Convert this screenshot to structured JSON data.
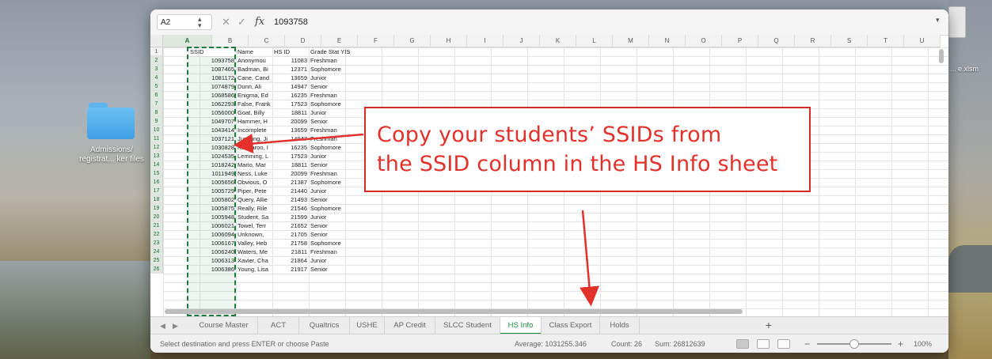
{
  "desktop": {
    "folder_label_line1": "Admissions/",
    "folder_label_line2": "registrat... ker files",
    "right_file_label": "... e.xlsm"
  },
  "formula_bar": {
    "name_box": "A2",
    "fx": "fx",
    "value": "1093758"
  },
  "columns": [
    "A",
    "B",
    "C",
    "D",
    "E",
    "F",
    "G",
    "H",
    "I",
    "J",
    "K",
    "L",
    "M",
    "N",
    "O",
    "P",
    "Q",
    "R",
    "S",
    "T",
    "U"
  ],
  "rows": [
    {
      "n": "1",
      "a": "SSID",
      "b": "Name",
      "c": "HS ID",
      "d": "Grade Stat YIS"
    },
    {
      "n": "2",
      "a": "1093758",
      "b": "Anonymou",
      "c": "11083",
      "d": "Freshman"
    },
    {
      "n": "3",
      "a": "1087465",
      "b": "Badman, Bi",
      "c": "12371",
      "d": "Sophomore"
    },
    {
      "n": "4",
      "a": "1081172",
      "b": "Cane, Cand",
      "c": "13659",
      "d": "Junior"
    },
    {
      "n": "5",
      "a": "1074879",
      "b": "Dunn, Ali",
      "c": "14947",
      "d": "Senior"
    },
    {
      "n": "6",
      "a": "1068586",
      "b": "Enigma, Ed",
      "c": "16235",
      "d": "Freshman"
    },
    {
      "n": "7",
      "a": "1062293",
      "b": "False, Frank",
      "c": "17523",
      "d": "Sophomore"
    },
    {
      "n": "8",
      "a": "1056000",
      "b": "Goat, Billy",
      "c": "18811",
      "d": "Junior"
    },
    {
      "n": "9",
      "a": "1049707",
      "b": "Hammer, H",
      "c": "20099",
      "d": "Senior"
    },
    {
      "n": "10",
      "a": "1043414",
      "b": "Incomplete",
      "c": "13659",
      "d": "Freshman"
    },
    {
      "n": "11",
      "a": "1037121",
      "b": "Jumping, Ji",
      "c": "14947",
      "d": "Freshman"
    },
    {
      "n": "12",
      "a": "1030828",
      "b": "Kangaroo, I",
      "c": "16235",
      "d": "Sophomore"
    },
    {
      "n": "13",
      "a": "1024535",
      "b": "Lemming, L",
      "c": "17523",
      "d": "Junior"
    },
    {
      "n": "14",
      "a": "1018242",
      "b": "Mario, Mar",
      "c": "18811",
      "d": "Senior"
    },
    {
      "n": "15",
      "a": "1011949",
      "b": "Ness, Luke",
      "c": "20099",
      "d": "Freshman"
    },
    {
      "n": "16",
      "a": "1005656",
      "b": "Obvious, O",
      "c": "21387",
      "d": "Sophomore"
    },
    {
      "n": "17",
      "a": "1005729",
      "b": "Piper, Pete",
      "c": "21440",
      "d": "Junior"
    },
    {
      "n": "18",
      "a": "1005802",
      "b": "Query, Allie",
      "c": "21493",
      "d": "Senior"
    },
    {
      "n": "19",
      "a": "1005875",
      "b": "Really, Rile",
      "c": "21546",
      "d": "Sophomore"
    },
    {
      "n": "20",
      "a": "1005948",
      "b": "Student, Sa",
      "c": "21599",
      "d": "Junior"
    },
    {
      "n": "21",
      "a": "1006021",
      "b": "Towel, Terr",
      "c": "21652",
      "d": "Senior"
    },
    {
      "n": "22",
      "a": "1006094",
      "b": "Unknown,",
      "c": "21705",
      "d": "Senior"
    },
    {
      "n": "23",
      "a": "1006167",
      "b": "Valley, Heb",
      "c": "21758",
      "d": "Sophomore"
    },
    {
      "n": "24",
      "a": "1006240",
      "b": "Waters, Me",
      "c": "21811",
      "d": "Freshman"
    },
    {
      "n": "25",
      "a": "1006313",
      "b": "Xavier, Cha",
      "c": "21864",
      "d": "Junior"
    },
    {
      "n": "26",
      "a": "1006386",
      "b": "Young, Lisa",
      "c": "21917",
      "d": "Senior"
    }
  ],
  "sheet_tabs": [
    "Course Master",
    "ACT",
    "Qualtrics",
    "USHE",
    "AP Credit",
    "SLCC Student",
    "HS Info",
    "Class Export",
    "Holds"
  ],
  "active_tab": "HS Info",
  "add_tab": "+",
  "status": {
    "message": "Select destination and press ENTER or choose Paste",
    "average": "Average: 1031255.346",
    "count": "Count: 26",
    "sum": "Sum: 26812639",
    "zoom_minus": "−",
    "zoom_plus": "+",
    "zoom": "100%",
    "zoom_level": 0.5
  },
  "annotation": {
    "line1": "Copy your students’ SSIDs from",
    "line2": "the SSID column in the HS Info sheet",
    "color": "#e2302b"
  }
}
